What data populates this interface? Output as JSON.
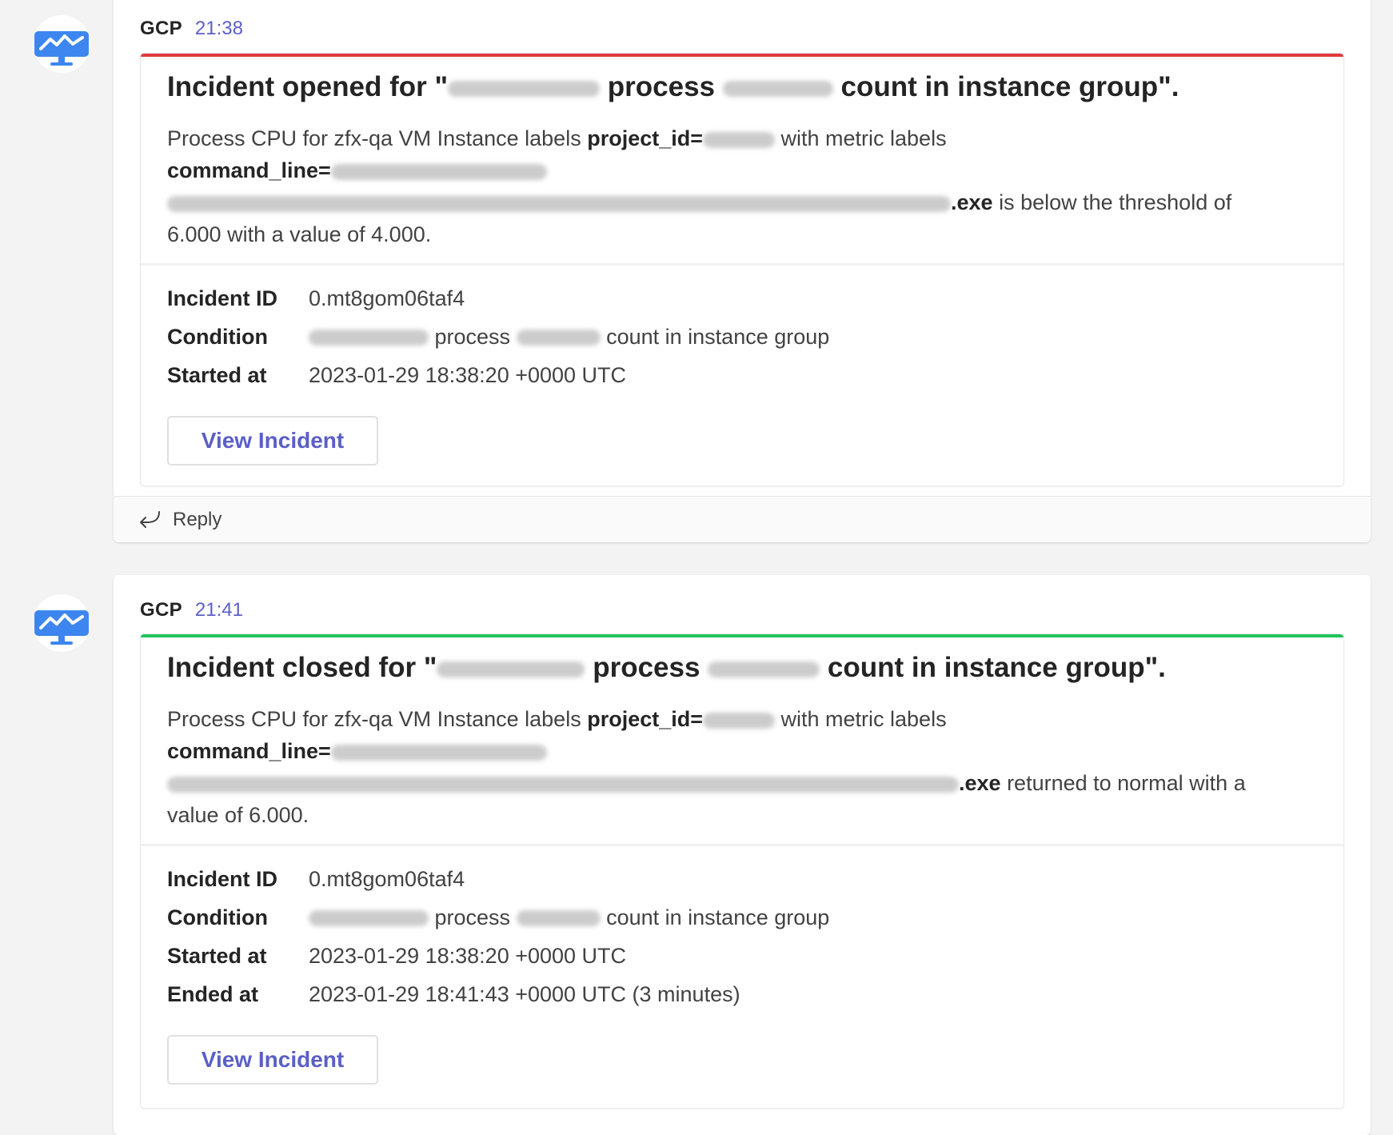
{
  "colors": {
    "accent": "#5b5fc7",
    "opened_bar": "#e03a3e",
    "closed_bar": "#22c35a",
    "avatar_icon": "#3d86f0"
  },
  "messages": [
    {
      "sender": "GCP",
      "time": "21:38",
      "avatar_icon": "monitor-chart-icon",
      "card": {
        "status": "opened",
        "title_prefix": "Incident opened for \"",
        "title_mid": " process ",
        "title_suffix": " count in instance group\".",
        "desc_lead": "Process CPU for zfx-qa VM Instance labels ",
        "desc_project_key": "project_id=",
        "desc_metric": " with metric labels",
        "desc_command_key": "command_line=",
        "desc_exe": ".exe",
        "desc_tail": " is below the threshold of 6.000 with a value of 4.000.",
        "facts": {
          "incident_id_label": "Incident ID",
          "incident_id": "0.mt8gom06taf4",
          "condition_label": "Condition",
          "condition_mid": "process",
          "condition_suffix": "count in instance group",
          "started_label": "Started at",
          "started": "2023-01-29 18:38:20 +0000 UTC"
        },
        "button": "View Incident"
      },
      "reply": "Reply"
    },
    {
      "sender": "GCP",
      "time": "21:41",
      "avatar_icon": "monitor-chart-icon",
      "card": {
        "status": "closed",
        "title_prefix": "Incident closed for \"",
        "title_mid": " process ",
        "title_suffix": " count in instance group\".",
        "desc_lead": "Process CPU for zfx-qa VM Instance labels ",
        "desc_project_key": "project_id=",
        "desc_metric": " with metric labels",
        "desc_command_key": "command_line=",
        "desc_exe": ".exe",
        "desc_tail": " returned to normal with a value of 6.000.",
        "facts": {
          "incident_id_label": "Incident ID",
          "incident_id": "0.mt8gom06taf4",
          "condition_label": "Condition",
          "condition_mid": "process",
          "condition_suffix": "count in instance group",
          "started_label": "Started at",
          "started": "2023-01-29 18:38:20 +0000 UTC",
          "ended_label": "Ended at",
          "ended": "2023-01-29 18:41:43 +0000 UTC (3 minutes)"
        },
        "button": "View Incident"
      }
    }
  ]
}
